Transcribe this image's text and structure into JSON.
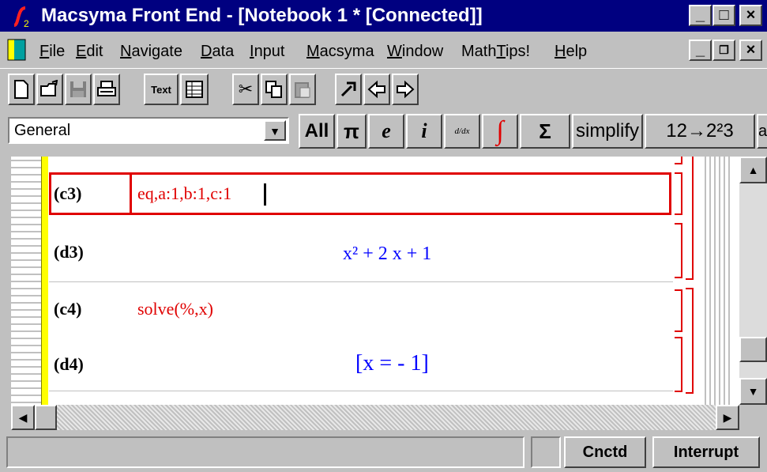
{
  "window": {
    "title": "Macsyma Front End - [Notebook 1 * [Connected]]",
    "min_glyph": "_",
    "max_glyph": "□",
    "close_glyph": "×"
  },
  "menubar": {
    "items": [
      "File",
      "Edit",
      "Navigate",
      "Data",
      "Input",
      "Macsyma",
      "Window",
      "MathTips!",
      "Help"
    ],
    "doc_min": "_",
    "doc_restore": "ꟿ",
    "doc_close": "×"
  },
  "toolbar": {
    "text_button": "Text",
    "cut_glyph": "✂"
  },
  "mathbar": {
    "style_combo": "General",
    "buttons": [
      "All",
      "π",
      "e",
      "i",
      "d/dx",
      "∫",
      "Σ",
      "simplify",
      "12→2²3",
      "ar"
    ]
  },
  "notebook": {
    "cells": [
      {
        "label": "(c3)",
        "kind": "input",
        "text": "eq,a:1,b:1,c:1"
      },
      {
        "label": "(d3)",
        "kind": "output",
        "text": "x² + 2 x + 1"
      },
      {
        "label": "(c4)",
        "kind": "input",
        "text": "solve(%,x)"
      },
      {
        "label": "(d4)",
        "kind": "output",
        "text": "[x = - 1]"
      }
    ]
  },
  "statusbar": {
    "message": "",
    "cnctd": "Cnctd",
    "interrupt": "Interrupt"
  },
  "colors": {
    "titlebar": "#000080",
    "input_text": "#e00000",
    "output_text": "#0000ff",
    "yellow_margin": "#ffff00"
  }
}
